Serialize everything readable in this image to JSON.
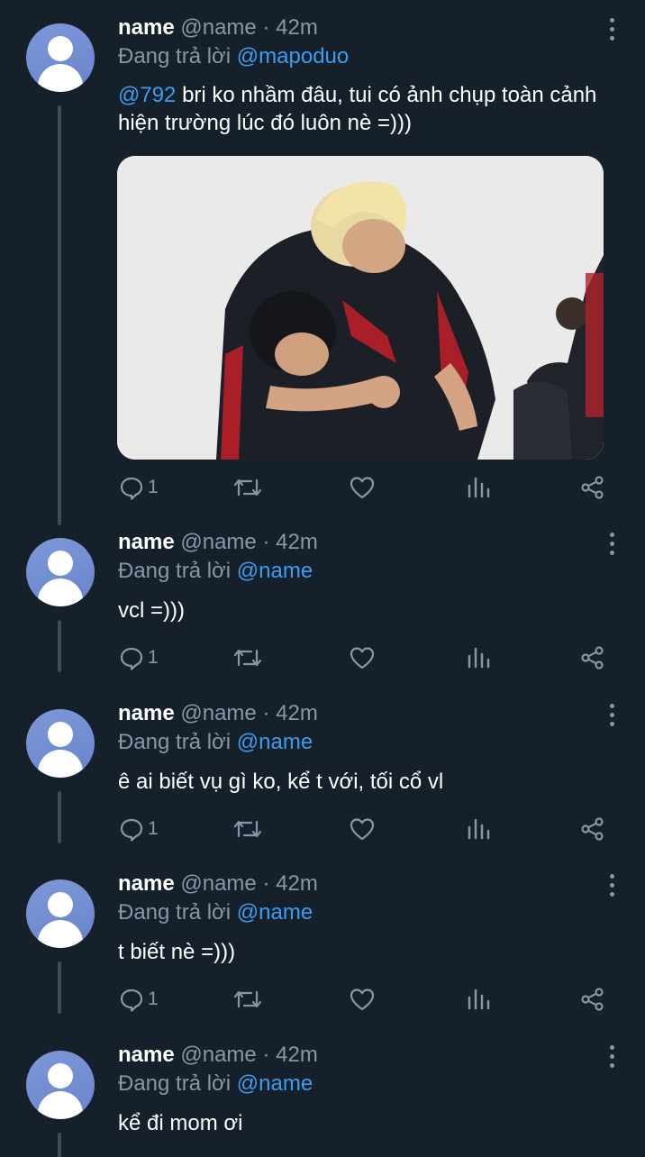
{
  "colors": {
    "background": "#16202b",
    "muted_text": "#8897a8",
    "link": "#3b9df0",
    "thread_line": "#3d4b5a",
    "avatar": "#7189d0"
  },
  "icons": {
    "reply": "speech-bubble-icon",
    "retweet": "retweet-arrows-icon",
    "like": "heart-icon",
    "stats": "bar-chart-icon",
    "share": "share-nodes-icon",
    "more": "vertical-dots-icon"
  },
  "tweets": [
    {
      "display_name": "name",
      "handle": "@name",
      "separator": "·",
      "time": "42m",
      "reply_prefix": "Đang trả lời",
      "reply_to": "@mapoduo",
      "text_mention": "@792",
      "text": " bri ko nhầm đâu, tui có ảnh chụp toàn cảnh hiện trường lúc đó luôn nè =)))",
      "has_media": true,
      "reply_count": "1"
    },
    {
      "display_name": "name",
      "handle": "@name",
      "separator": "·",
      "time": "42m",
      "reply_prefix": "Đang trả lời",
      "reply_to": "@name",
      "text": "vcl =)))",
      "reply_count": "1"
    },
    {
      "display_name": "name",
      "handle": "@name",
      "separator": "·",
      "time": "42m",
      "reply_prefix": "Đang trả lời",
      "reply_to": "@name",
      "text": "ê ai biết vụ gì ko, kể t với, tối cổ vl",
      "reply_count": "1"
    },
    {
      "display_name": "name",
      "handle": "@name",
      "separator": "·",
      "time": "42m",
      "reply_prefix": "Đang trả lời",
      "reply_to": "@name",
      "text": "t biết nè =)))",
      "reply_count": "1"
    },
    {
      "display_name": "name",
      "handle": "@name",
      "separator": "·",
      "time": "42m",
      "reply_prefix": "Đang trả lời",
      "reply_to": "@name",
      "text": "kể đi mom ơi"
    }
  ]
}
